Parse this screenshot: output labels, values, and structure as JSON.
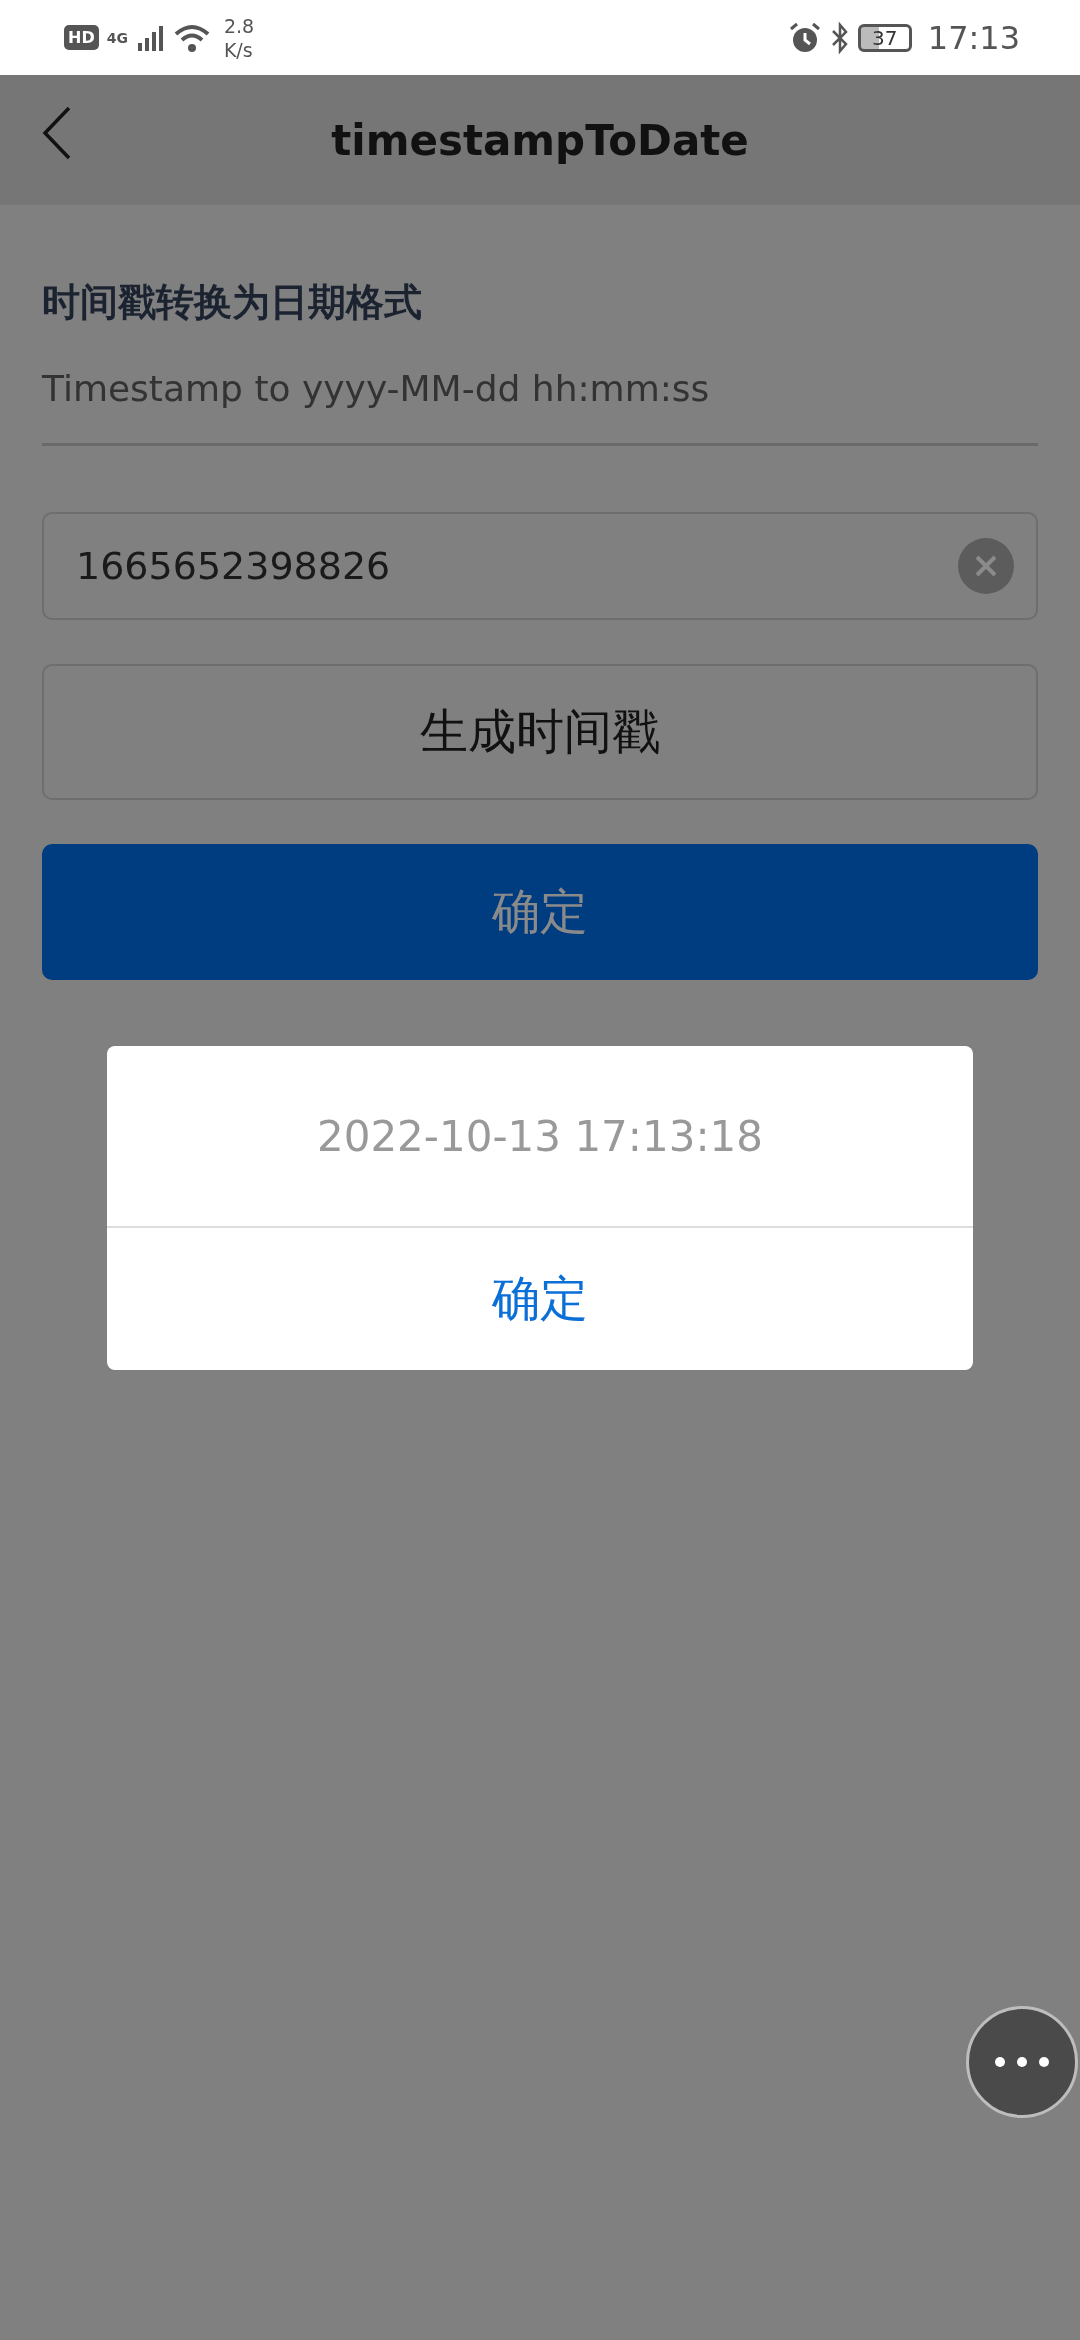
{
  "status_bar": {
    "network_badge": "HD",
    "network_type": "4G",
    "speed_value": "2.8",
    "speed_unit": "K/s",
    "battery": "37",
    "time": "17:13"
  },
  "nav_bar": {
    "title": "timestampToDate"
  },
  "header": {
    "title": "时间戳转换为日期格式",
    "subtitle": "Timestamp to yyyy-MM-dd hh:mm:ss"
  },
  "timestamp_field": {
    "value": "1665652398826"
  },
  "generate_button": {
    "label": "生成时间戳"
  },
  "confirm_button": {
    "label": "确定"
  },
  "dialog": {
    "message": "2022-10-13 17:13:18",
    "button": "确定"
  }
}
